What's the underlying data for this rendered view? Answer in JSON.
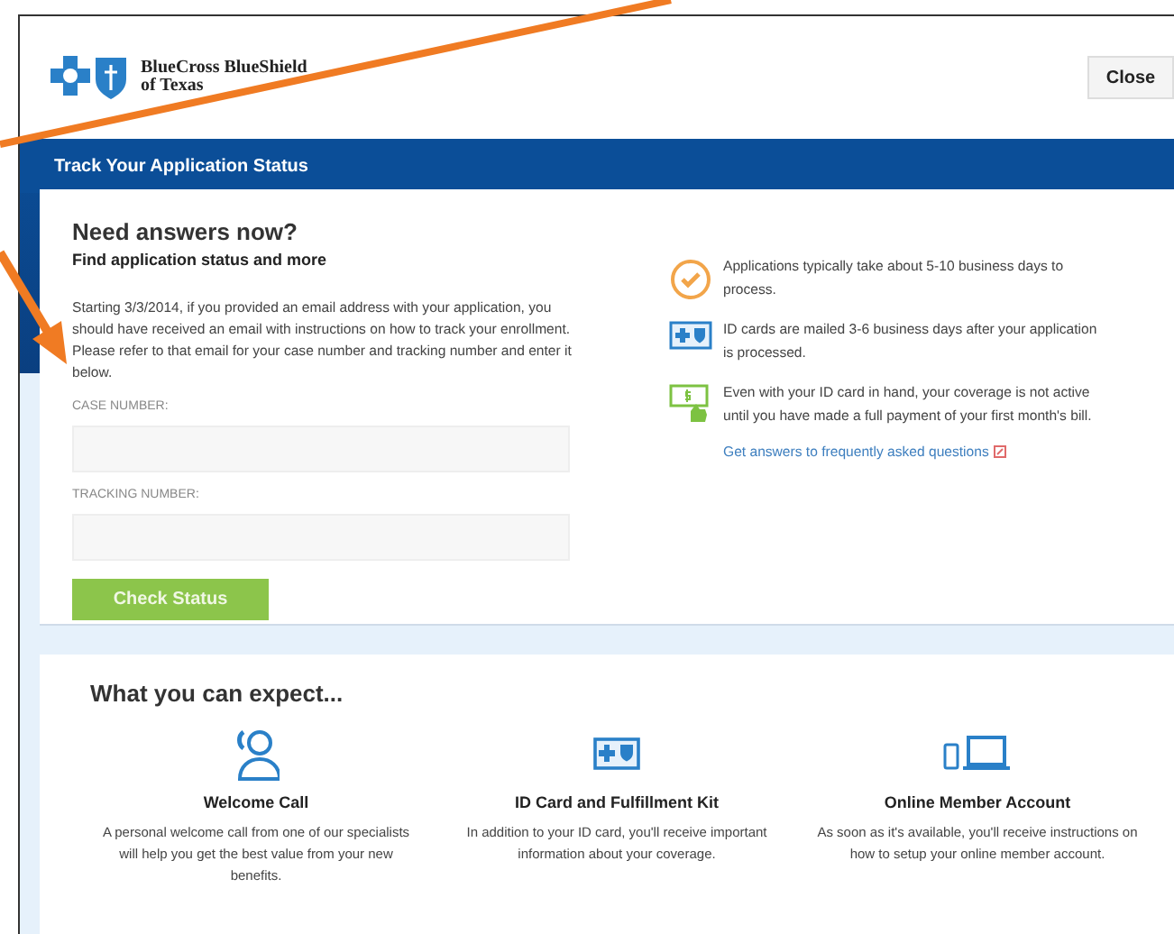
{
  "header": {
    "logo_text": [
      "BlueCross BlueShield",
      "of Texas"
    ],
    "close_button": "Close"
  },
  "title_bar": {
    "title": "Track Your Application Status"
  },
  "status_card": {
    "heading": "Need answers now?",
    "subheading": "Find application status and more",
    "intro": "Starting 3/3/2014, if you provided an email address with your application, you should have received an email with instructions on how to track your enrollment. Please refer to that email for your case number and tracking number and enter it below.",
    "fields": [
      {
        "label": "CASE NUMBER:"
      },
      {
        "label": "TRACKING NUMBER:"
      }
    ],
    "button": "Check Status",
    "info": [
      {
        "kind": "clock",
        "text": "Applications typically take about 5-10 business days to process."
      },
      {
        "kind": "card",
        "text": "ID cards are mailed 3-6 business days after your application is processed."
      },
      {
        "kind": "payment",
        "text": "Even with your ID card in hand, your coverage is not active until you have made a full payment of your first month's bill."
      }
    ],
    "faq_link": "Get answers to frequently asked questions"
  },
  "expect": {
    "heading": "What you can expect...",
    "items": [
      {
        "kind": "call",
        "title": "Welcome Call",
        "text": "A personal welcome call from one of our specialists will help you get the best value from your new benefits."
      },
      {
        "kind": "card",
        "title": "ID Card and Fulfillment Kit",
        "text": "In addition to your ID card, you'll receive important information about your coverage."
      },
      {
        "kind": "devices",
        "title": "Online Member Account",
        "text": "As soon as it's available, you'll receive instructions on how to setup your online member account."
      }
    ]
  }
}
